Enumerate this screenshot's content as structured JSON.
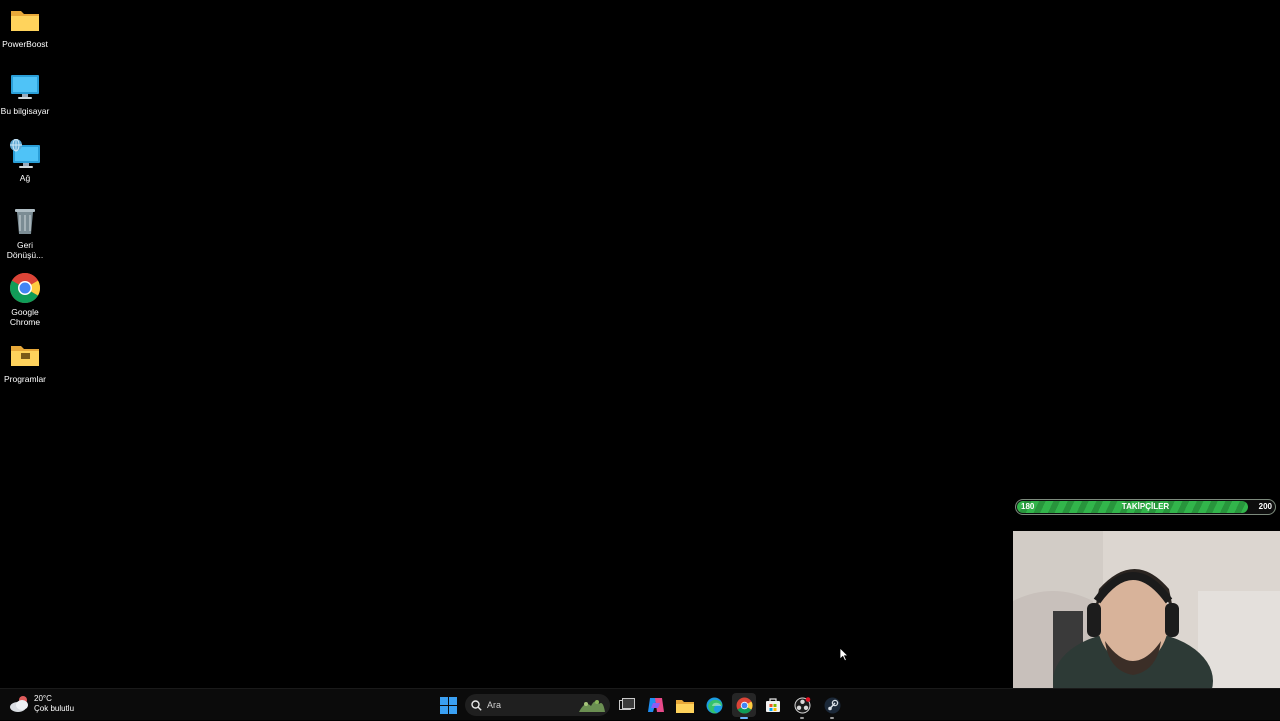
{
  "desktop": {
    "icons": [
      {
        "label": "PowerBoost",
        "icon": "folder-icon"
      },
      {
        "label": "Bu bilgisayar",
        "icon": "monitor-icon"
      },
      {
        "label": "Ağ",
        "icon": "network-icon"
      },
      {
        "label": "Geri Dönüşü...",
        "icon": "recycle-bin-icon"
      },
      {
        "label": "Google Chrome",
        "icon": "chrome-icon"
      },
      {
        "label": "Programlar",
        "icon": "folder-icon"
      }
    ]
  },
  "overlay": {
    "follower_goal": {
      "title": "TAKİPÇİLER",
      "current": "180",
      "target": "200",
      "progress": 0.9,
      "color": "#32b54b"
    }
  },
  "taskbar": {
    "weather": {
      "temperature": "20°C",
      "condition": "Çok bulutlu"
    },
    "search": {
      "placeholder": "Ara"
    },
    "apps": [
      {
        "name": "start",
        "icon": "windows-start-icon"
      },
      {
        "name": "task-view",
        "icon": "task-view-icon"
      },
      {
        "name": "copilot",
        "icon": "copilot-icon"
      },
      {
        "name": "file-explorer",
        "icon": "file-explorer-icon"
      },
      {
        "name": "edge",
        "icon": "edge-icon"
      },
      {
        "name": "chrome",
        "icon": "chrome-icon",
        "active": true
      },
      {
        "name": "microsoft-store",
        "icon": "store-icon"
      },
      {
        "name": "obs",
        "icon": "obs-icon"
      },
      {
        "name": "steam",
        "icon": "steam-icon"
      }
    ],
    "accent": "#0078d4"
  }
}
